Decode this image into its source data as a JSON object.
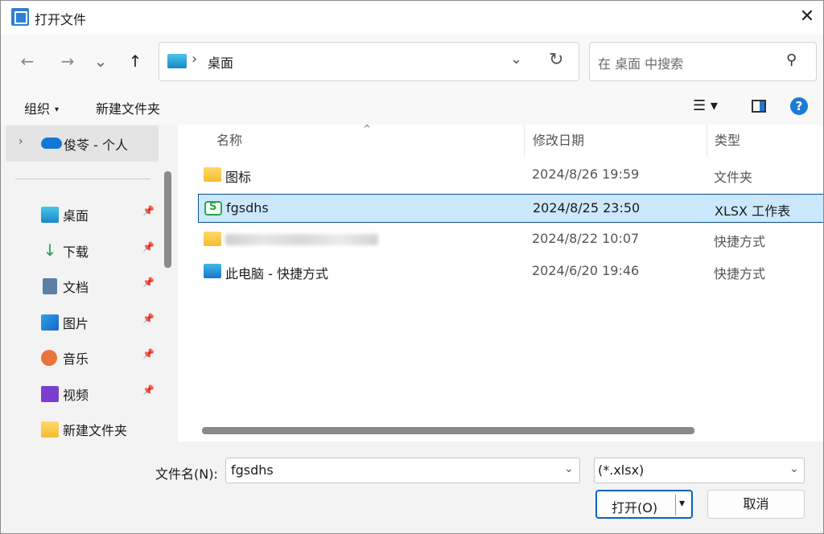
{
  "window": {
    "title": "打开文件",
    "close_glyph": "✕"
  },
  "nav": {
    "back_glyph": "←",
    "forward_glyph": "→",
    "recent_glyph": "⌄",
    "up_glyph": "↑",
    "address_sep": "›",
    "address_location": "桌面",
    "address_dropdown_glyph": "⌄",
    "refresh_glyph": "↻",
    "search_placeholder": "在 桌面 中搜索",
    "search_glyph": "⚲"
  },
  "toolbar": {
    "organize_label": "组织",
    "organize_caret": "▾",
    "new_folder_label": "新建文件夹",
    "view_glyph": "☰ ▾",
    "help_glyph": "?"
  },
  "sidebar": {
    "onedrive": {
      "chevron": "›",
      "label": "俊苓 - 个人"
    },
    "pin_glyph": "📌",
    "items": [
      {
        "label": "桌面",
        "icon": "desktop-icon",
        "pinned": true
      },
      {
        "label": "下载",
        "icon": "download-icon",
        "pinned": true
      },
      {
        "label": "文档",
        "icon": "document-icon",
        "pinned": true
      },
      {
        "label": "图片",
        "icon": "picture-icon",
        "pinned": true
      },
      {
        "label": "音乐",
        "icon": "music-icon",
        "pinned": true
      },
      {
        "label": "视频",
        "icon": "video-icon",
        "pinned": true
      },
      {
        "label": "新建文件夹",
        "icon": "folder-icon",
        "pinned": false
      }
    ]
  },
  "columns": {
    "name": "名称",
    "modified": "修改日期",
    "type": "类型",
    "sort_glyph": "^"
  },
  "files": [
    {
      "name": "图标",
      "date": "2024/8/26 19:59",
      "type": "文件夹",
      "icon": "folder-icon",
      "selected": false
    },
    {
      "name": "fgsdhs",
      "date": "2024/8/25 23:50",
      "type": "XLSX 工作表",
      "icon": "xlsx-icon",
      "selected": true
    },
    {
      "name": "",
      "date": "2024/8/22 10:07",
      "type": "快捷方式",
      "icon": "folder-icon",
      "selected": false
    },
    {
      "name": "此电脑 - 快捷方式",
      "date": "2024/6/20 19:46",
      "type": "快捷方式",
      "icon": "pc-shortcut-icon",
      "selected": false
    }
  ],
  "footer": {
    "filename_label": "文件名(N):",
    "filename_value": "fgsdhs",
    "dropdown_glyph": "⌄",
    "filetype_value": "(*.xlsx)",
    "open_label": "打开(O)",
    "open_dd_glyph": "▾",
    "cancel_label": "取消"
  },
  "colors": {
    "accent": "#0a63c4",
    "selection": "#cce8ff",
    "folder": "#f5bd2f",
    "excel": "#28a745"
  }
}
